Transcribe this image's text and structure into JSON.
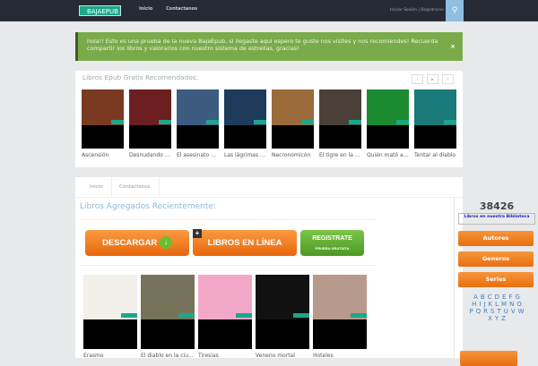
{
  "nav": {
    "logo": "BAJAEPUB",
    "links": [
      "Inicio",
      "Contactanos"
    ],
    "login": "Iniciar Sesión | Registrarse",
    "search_icon": "search-icon"
  },
  "alert": {
    "text": "hola!! Esto es una prueba de la nueva BajaEpub, si llegaste aqui espero te guste nos visites y nos recomiendes! Recuerda compartir los libros y valorarlos con nuestro sistema de estrellas, gracias!",
    "close": "×"
  },
  "recommended": {
    "title": "Libros Epub Gratis Recomendados:",
    "controls": [
      "‹",
      "▸",
      "›"
    ],
    "books": [
      {
        "title": "Ascensión",
        "color": "#7a3a22"
      },
      {
        "title": "Desnudando a...",
        "color": "#6b1f1f"
      },
      {
        "title": "El asesinato d...",
        "color": "#3d5a80"
      },
      {
        "title": "Las lágrimas d...",
        "color": "#1f3b5c"
      },
      {
        "title": "Necronomicón",
        "color": "#9a6a3a"
      },
      {
        "title": "El tigre en la n...",
        "color": "#4a4038"
      },
      {
        "title": "Quién mató a ...",
        "color": "#1c8a30"
      },
      {
        "title": "Tentar al diablo",
        "color": "#1a7a7a"
      }
    ]
  },
  "main": {
    "tabs": [
      "Inicio",
      "Contactanos"
    ],
    "title": "Libros Agregados Recientemente:",
    "banners": {
      "download": "DESCARGAR",
      "online": "LIBROS EN LÍNEA",
      "register": "REGISTRATE",
      "register_sub": "PRUEBA GRATUITA"
    },
    "books": [
      {
        "title": "Erasmo",
        "color": "#f3f0ea"
      },
      {
        "title": "El diablo en la ciu...",
        "color": "#77735a"
      },
      {
        "title": "Tiresias",
        "color": "#f4a8c8"
      },
      {
        "title": "Veneno mortal",
        "color": "#111111"
      },
      {
        "title": "Hoteles",
        "color": "#b89a8c"
      }
    ]
  },
  "sidebar": {
    "count": "38426",
    "count_label": "Libros en nuestra Biblioteca",
    "buttons": [
      "Autores",
      "Generos",
      "Series"
    ],
    "letters": [
      "A",
      "B",
      "C",
      "D",
      "E",
      "F",
      "G",
      "H",
      "I",
      "J",
      "K",
      "L",
      "M",
      "N",
      "O",
      "P",
      "Q",
      "R",
      "S",
      "T",
      "U",
      "V",
      "W",
      "X",
      "Y",
      "Z"
    ]
  }
}
